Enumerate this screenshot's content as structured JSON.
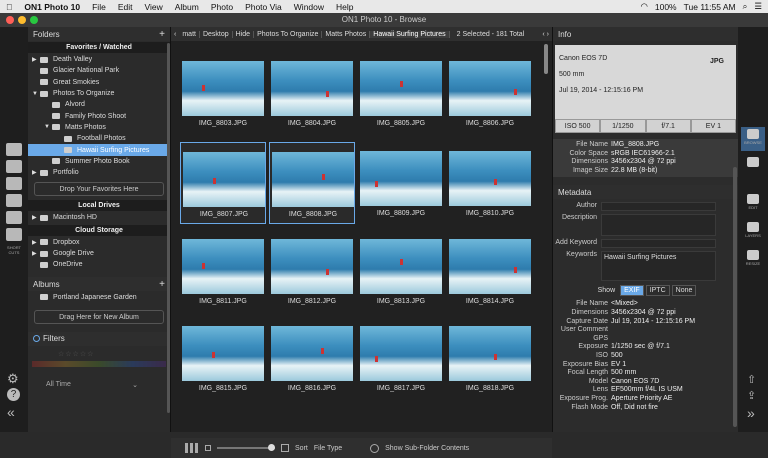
{
  "menubar": {
    "app": "ON1 Photo 10",
    "items": [
      "File",
      "Edit",
      "View",
      "Album",
      "Photo",
      "Photo Via",
      "Window",
      "Help"
    ],
    "battery": "100%",
    "day": "Tue 11:55 AM"
  },
  "window": {
    "title": "ON1 Photo 10 - Browse"
  },
  "folders": {
    "header": "Folders",
    "fav_title": "Favorites / Watched",
    "items": [
      "Death Valley",
      "Glacier National Park",
      "Great Smokies",
      "Photos To Organize",
      "Alvord",
      "Family Photo Shoot",
      "Matts Photos",
      "Football Photos",
      "Hawaii Surfing Pictures",
      "Summer Photo Book",
      "Portfolio"
    ],
    "drop_favorites": "Drop Your Favorites Here",
    "local_title": "Local Drives",
    "local": [
      "Macintosh HD"
    ],
    "cloud_title": "Cloud Storage",
    "cloud": [
      "Dropbox",
      "Google Drive",
      "OneDrive"
    ],
    "albums_header": "Albums",
    "albums": [
      "Portland Japanese Garden"
    ],
    "drop_album": "Drag Here for New Album",
    "filters": "Filters",
    "all_time": "All Time",
    "short_cuts": "SHORT CUTS"
  },
  "breadcrumb": {
    "items": [
      "matt",
      "Desktop",
      "Hide",
      "Photos To Organize",
      "Matts Photos",
      "Hawaii Surfing Pictures"
    ],
    "status": "2 Selected - 181 Total"
  },
  "thumbs": [
    "IMG_8803.JPG",
    "IMG_8804.JPG",
    "IMG_8805.JPG",
    "IMG_8806.JPG",
    "IMG_8807.JPG",
    "IMG_8808.JPG",
    "IMG_8809.JPG",
    "IMG_8810.JPG",
    "IMG_8811.JPG",
    "IMG_8812.JPG",
    "IMG_8813.JPG",
    "IMG_8814.JPG",
    "IMG_8815.JPG",
    "IMG_8816.JPG",
    "IMG_8817.JPG",
    "IMG_8818.JPG"
  ],
  "bottombar": {
    "sort": "Sort",
    "sort_value": "File Type",
    "subfolders": "Show Sub-Folder Contents"
  },
  "info": {
    "header": "Info",
    "camera": "Canon EOS 7D",
    "format": "JPG",
    "lens": "500 mm",
    "date": "Jul 19, 2014 - 12:15:16 PM",
    "exposure": [
      "ISO 500",
      "1/1250",
      "f/7.1",
      "EV 1"
    ],
    "file": [
      [
        "File Name",
        "IMG_8808.JPG"
      ],
      [
        "Color Space",
        "sRGB IEC61966-2.1"
      ],
      [
        "Dimensions",
        "3456x2304 @ 72 ppi"
      ],
      [
        "Image Size",
        "22.8 MB (8-bit)"
      ]
    ]
  },
  "metadata": {
    "header": "Metadata",
    "author": "Author",
    "description": "Description",
    "add_keyword": "Add Keyword",
    "keywords_label": "Keywords",
    "keywords_value": "Hawaii Surfing Pictures",
    "show": "Show",
    "tabs": [
      "EXIF",
      "IPTC",
      "None"
    ],
    "exif": [
      [
        "File Name",
        "<Mixed>"
      ],
      [
        "Dimensions",
        "3456x2304 @ 72 ppi"
      ],
      [
        "Capture Date",
        "Jul 19, 2014 - 12:15:16 PM"
      ],
      [
        "User Comment",
        ""
      ],
      [
        "GPS",
        ""
      ],
      [
        "",
        ""
      ],
      [
        "Exposure",
        "1/1250 sec @ f/7.1"
      ],
      [
        "ISO",
        "500"
      ],
      [
        "Exposure Bias",
        "EV 1"
      ],
      [
        "Focal Length",
        "500 mm"
      ],
      [
        "",
        ""
      ],
      [
        "Model",
        "Canon EOS 7D"
      ],
      [
        "Lens",
        "EF500mm f/4L IS USM"
      ],
      [
        "Exposure Prog.",
        "Aperture Priority AE"
      ],
      [
        "Flash Mode",
        "Off, Did not fire"
      ]
    ]
  },
  "rightstrip": [
    "BROWSE",
    "",
    "EDIT",
    "LAYERS",
    "RESIZE"
  ]
}
